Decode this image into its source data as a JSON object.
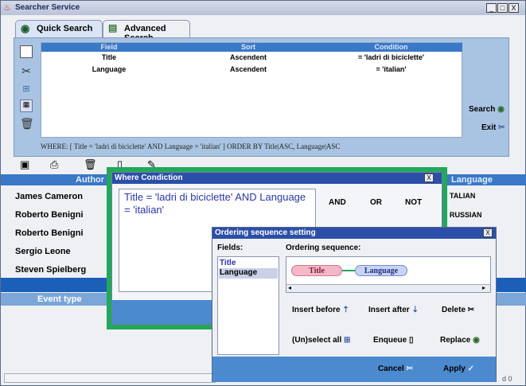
{
  "window": {
    "title": "Searcher Service",
    "min": "_",
    "max": "□",
    "close": "X"
  },
  "tabs": [
    {
      "label": "Quick Search"
    },
    {
      "label": "Advanced Search"
    }
  ],
  "grid": {
    "headers": [
      "Field",
      "Sort",
      "Condition"
    ],
    "rows": [
      [
        "Title",
        "Ascendent",
        "= 'ladri di biciclette'"
      ],
      [
        "Language",
        "Ascendent",
        "= 'italian'"
      ]
    ]
  },
  "side_actions": {
    "search": "Search",
    "exit": "Exit"
  },
  "where_clause": "WHERE: [  Title = 'ladri di biciclette' AND Language = 'italian'  ] ORDER BY Title|ASC, Language|ASC",
  "results": {
    "header_author": "Author",
    "header_language": "Language",
    "authors": [
      "James Cameron",
      "Roberto Benigni",
      "Roberto Benigni",
      "Sergio Leone",
      "Steven Spielberg"
    ],
    "languages": [
      "TALIAN",
      "RUSSIAN"
    ],
    "event_type": "Event type",
    "status_fragment": "d 0"
  },
  "where_dialog": {
    "title": "Where Condiction",
    "close": "X",
    "text": "Title = 'ladri di bicicl",
    "text_full": "Title = 'ladri di biciclette' AND Language = 'italian'",
    "ops": [
      "AND",
      "OR",
      "NOT"
    ]
  },
  "ordering_dialog": {
    "title": "Ordering sequence setting",
    "close": "X",
    "fields_label": "Fields:",
    "sequence_label": "Ordering sequence:",
    "fields": [
      "Title",
      "Language"
    ],
    "sequence": [
      "Title",
      "Language"
    ],
    "buttons": {
      "insert_before": "Insert before",
      "insert_after": "Insert after",
      "delete": "Delete",
      "unselect_all": "(Un)select all",
      "enqueue": "Enqueue",
      "replace": "Replace",
      "cancel": "Cancel",
      "apply": "Apply"
    }
  }
}
